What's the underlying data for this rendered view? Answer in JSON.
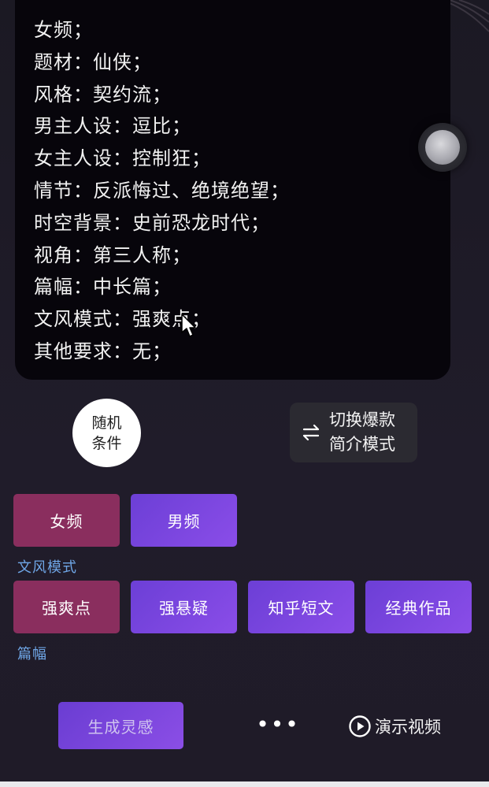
{
  "prompt": {
    "lines": [
      "女频；",
      "题材：仙侠；",
      "风格：契约流；",
      "男主人设：逗比；",
      "女主人设：控制狂；",
      "情节：反派悔过、绝境绝望；",
      "时空背景：史前恐龙时代；",
      "视角：第三人称；",
      "篇幅：中长篇；",
      "文风模式：强爽点；",
      "其他要求：无；"
    ]
  },
  "random_button": {
    "line1": "随机",
    "line2": "条件"
  },
  "switch_button": {
    "line1": "切换爆款",
    "line2": "简介模式",
    "icon": "swap-arrows-icon"
  },
  "gender_tags": [
    {
      "label": "女频",
      "selected": true
    },
    {
      "label": "男频",
      "selected": false
    }
  ],
  "style_section": {
    "label": "文风模式"
  },
  "style_tags": [
    {
      "label": "强爽点",
      "selected": true
    },
    {
      "label": "强悬疑",
      "selected": false
    },
    {
      "label": "知乎短文",
      "selected": false
    },
    {
      "label": "经典作品",
      "selected": false
    }
  ],
  "length_section": {
    "label": "篇幅"
  },
  "footer": {
    "generate_label": "生成灵感",
    "more_label": "•••",
    "demo_label": "演示视频",
    "demo_icon": "play-circle-icon"
  },
  "colors": {
    "selected_tag": "#8a2e5e",
    "unselected_tag": "#7a45e0",
    "section_label": "#6fa6e6",
    "card_bg": "#07050b"
  }
}
